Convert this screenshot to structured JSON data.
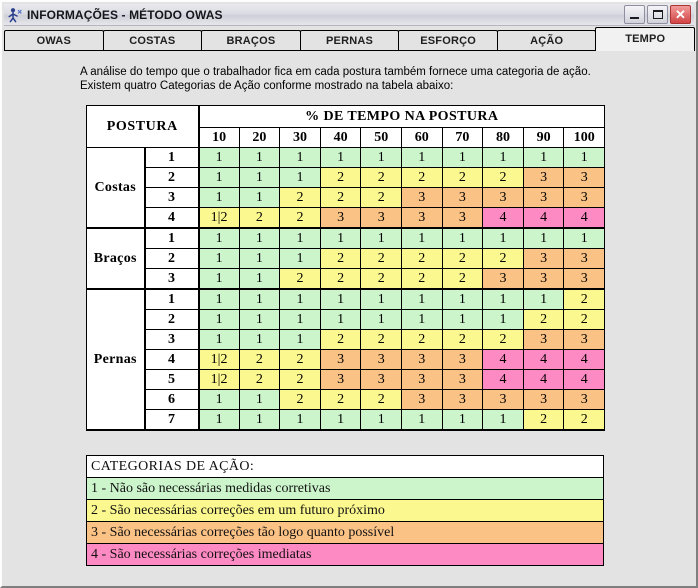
{
  "window": {
    "title": "INFORMAÇÕES - MÉTODO OWAS",
    "icon": "app-owas-icon",
    "buttons": {
      "minimize": "minimize-icon",
      "maximize": "maximize-icon",
      "close": "close-icon"
    }
  },
  "tabs": [
    {
      "label": "OWAS",
      "active": false
    },
    {
      "label": "COSTAS",
      "active": false
    },
    {
      "label": "BRAÇOS",
      "active": false
    },
    {
      "label": "PERNAS",
      "active": false
    },
    {
      "label": "ESFORÇO",
      "active": false
    },
    {
      "label": "AÇÃO",
      "active": false
    },
    {
      "label": "TEMPO",
      "active": true
    }
  ],
  "intro": {
    "line1": "A análise do tempo que o trabalhador fica em cada postura também fornece uma categoria de ação.",
    "line2": "Existem quatro Categorias de Ação conforme mostrado na tabela abaixo:"
  },
  "table": {
    "header_posture": "POSTURA",
    "header_time": "% DE TEMPO NA POSTURA",
    "percent_columns": [
      "10",
      "20",
      "30",
      "40",
      "50",
      "60",
      "70",
      "80",
      "90",
      "100"
    ],
    "groups": [
      {
        "name": "Costas",
        "rows": [
          {
            "id": "1",
            "values": [
              "1",
              "1",
              "1",
              "1",
              "1",
              "1",
              "1",
              "1",
              "1",
              "1"
            ]
          },
          {
            "id": "2",
            "values": [
              "1",
              "1",
              "1",
              "2",
              "2",
              "2",
              "2",
              "2",
              "3",
              "3"
            ]
          },
          {
            "id": "3",
            "values": [
              "1",
              "1",
              "2",
              "2",
              "2",
              "3",
              "3",
              "3",
              "3",
              "3"
            ]
          },
          {
            "id": "4",
            "values": [
              "1|2",
              "2",
              "2",
              "3",
              "3",
              "3",
              "3",
              "4",
              "4",
              "4"
            ]
          }
        ]
      },
      {
        "name": "Braços",
        "rows": [
          {
            "id": "1",
            "values": [
              "1",
              "1",
              "1",
              "1",
              "1",
              "1",
              "1",
              "1",
              "1",
              "1"
            ]
          },
          {
            "id": "2",
            "values": [
              "1",
              "1",
              "1",
              "2",
              "2",
              "2",
              "2",
              "2",
              "3",
              "3"
            ]
          },
          {
            "id": "3",
            "values": [
              "1",
              "1",
              "2",
              "2",
              "2",
              "2",
              "2",
              "3",
              "3",
              "3"
            ]
          }
        ]
      },
      {
        "name": "Pernas",
        "rows": [
          {
            "id": "1",
            "values": [
              "1",
              "1",
              "1",
              "1",
              "1",
              "1",
              "1",
              "1",
              "1",
              "2"
            ]
          },
          {
            "id": "2",
            "values": [
              "1",
              "1",
              "1",
              "1",
              "1",
              "1",
              "1",
              "1",
              "2",
              "2"
            ]
          },
          {
            "id": "3",
            "values": [
              "1",
              "1",
              "1",
              "2",
              "2",
              "2",
              "2",
              "2",
              "3",
              "3"
            ]
          },
          {
            "id": "4",
            "values": [
              "1|2",
              "2",
              "2",
              "3",
              "3",
              "3",
              "3",
              "4",
              "4",
              "4"
            ]
          },
          {
            "id": "5",
            "values": [
              "1|2",
              "2",
              "2",
              "3",
              "3",
              "3",
              "3",
              "4",
              "4",
              "4"
            ]
          },
          {
            "id": "6",
            "values": [
              "1",
              "1",
              "2",
              "2",
              "2",
              "3",
              "3",
              "3",
              "3",
              "3"
            ]
          },
          {
            "id": "7",
            "values": [
              "1",
              "1",
              "1",
              "1",
              "1",
              "1",
              "1",
              "1",
              "2",
              "2"
            ]
          }
        ]
      }
    ]
  },
  "legend": {
    "title": "CATEGORIAS DE AÇÃO:",
    "items": [
      {
        "text": "1 - Não são necessárias medidas corretivas",
        "color": "#ccf5cc"
      },
      {
        "text": "2 - São necessárias correções em um futuro próximo",
        "color": "#fbf88f"
      },
      {
        "text": "3 - São necessárias correções tão logo quanto possível",
        "color": "#fbc286"
      },
      {
        "text": "4 - São necessárias correções imediatas",
        "color": "#fd8ac2"
      }
    ]
  },
  "colors": {
    "cat1": "#ccf5cc",
    "cat2": "#fbf88f",
    "cat3": "#fbc286",
    "cat4": "#fd8ac2",
    "window_bg": "#e3e3e3",
    "tab_active_bg": "#f1f1f1"
  }
}
